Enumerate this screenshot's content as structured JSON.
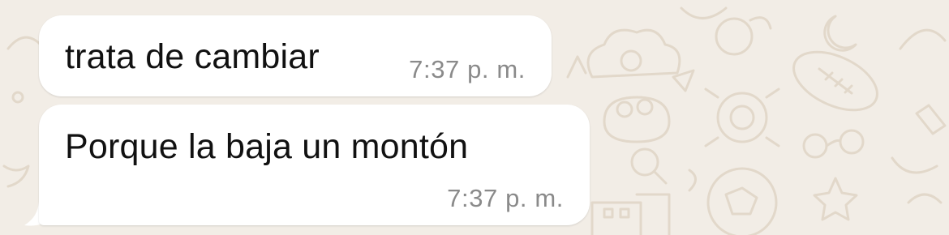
{
  "chat": {
    "background_color": "#f2ede6",
    "bubble_color": "#ffffff",
    "messages": [
      {
        "text": "trata de cambiar",
        "time": "7:37 p. m."
      },
      {
        "text": "Porque la baja un montón",
        "time": "7:37 p. m."
      }
    ]
  }
}
